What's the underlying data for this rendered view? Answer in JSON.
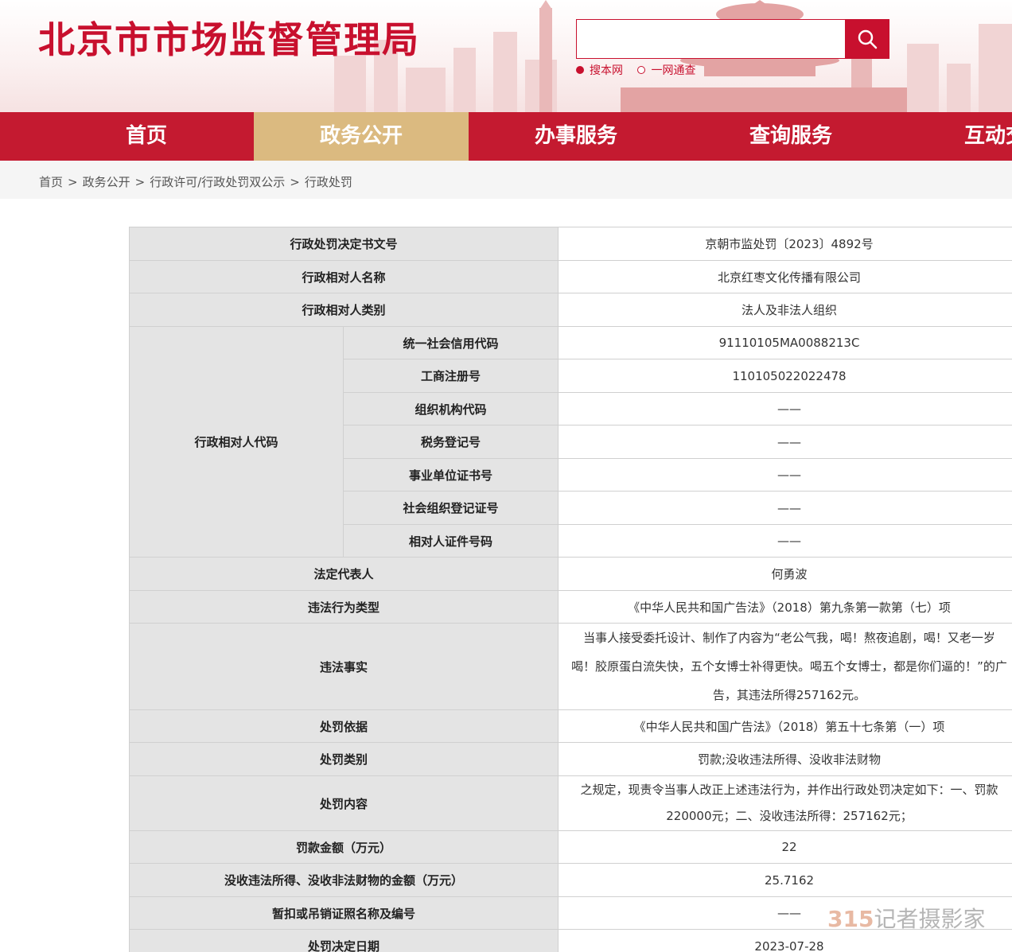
{
  "header": {
    "site_title": "北京市市场监督管理局",
    "search": {
      "placeholder": "",
      "scope_options": [
        "搜本网",
        "一网通查"
      ],
      "selected_scope": "搜本网"
    }
  },
  "nav": {
    "items": [
      "首页",
      "政务公开",
      "办事服务",
      "查询服务",
      "互动交流"
    ],
    "active": "政务公开"
  },
  "breadcrumb": [
    "首页",
    "政务公开",
    "行政许可/行政处罚双公示",
    "行政处罚"
  ],
  "breadcrumb_separator": ">",
  "details": {
    "decision_number": {
      "label": "行政处罚决定书文号",
      "value": "京朝市监处罚〔2023〕4892号"
    },
    "party_name": {
      "label": "行政相对人名称",
      "value": "北京红枣文化传播有限公司"
    },
    "party_type": {
      "label": "行政相对人类别",
      "value": "法人及非法人组织"
    },
    "party_codes": {
      "label": "行政相对人代码",
      "rows": [
        {
          "label": "统一社会信用代码",
          "value": "91110105MA0088213C"
        },
        {
          "label": "工商注册号",
          "value": "110105022022478"
        },
        {
          "label": "组织机构代码",
          "value": "——"
        },
        {
          "label": "税务登记号",
          "value": "——"
        },
        {
          "label": "事业单位证书号",
          "value": "——"
        },
        {
          "label": "社会组织登记证号",
          "value": "——"
        },
        {
          "label": "相对人证件号码",
          "value": "——"
        }
      ]
    },
    "legal_rep": {
      "label": "法定代表人",
      "value": "何勇波"
    },
    "violation_type": {
      "label": "违法行为类型",
      "value": "《中华人民共和国广告法》（2018）第九条第一款第（七）项"
    },
    "violation_facts": {
      "label": "违法事实",
      "lines": [
        "当事人接受委托设计、制作了内容为“老公气我，喝！熬夜追剧，喝！又老一岁",
        "喝！胶原蛋白流失快，五个女博士补得更快。喝五个女博士，都是你们逼的！”的广",
        "告，其违法所得257162元。"
      ]
    },
    "penalty_basis": {
      "label": "处罚依据",
      "value": "《中华人民共和国广告法》（2018）第五十七条第（一）项"
    },
    "penalty_category": {
      "label": "处罚类别",
      "value": "罚款;没收违法所得、没收非法财物"
    },
    "penalty_content": {
      "label": "处罚内容",
      "lines": [
        "之规定，现责令当事人改正上述违法行为，并作出行政处罚决定如下：一、罚款",
        "220000元；二、没收违法所得：257162元；"
      ]
    },
    "fine_amount": {
      "label": "罚款金额（万元）",
      "value": "22"
    },
    "confiscated_amount": {
      "label": "没收违法所得、没收非法财物的金额（万元）",
      "value": "25.7162"
    },
    "license_revoked": {
      "label": "暂扣或吊销证照名称及编号",
      "value": "——"
    },
    "decision_date": {
      "label": "处罚决定日期",
      "value": "2023-07-28"
    }
  },
  "watermark": {
    "number": "315",
    "text": "记者摄影家"
  },
  "colors": {
    "brand_red": "#c8102e",
    "nav_red": "#c41a30",
    "nav_active": "#dbba80",
    "label_bg": "#e4e4e4"
  }
}
